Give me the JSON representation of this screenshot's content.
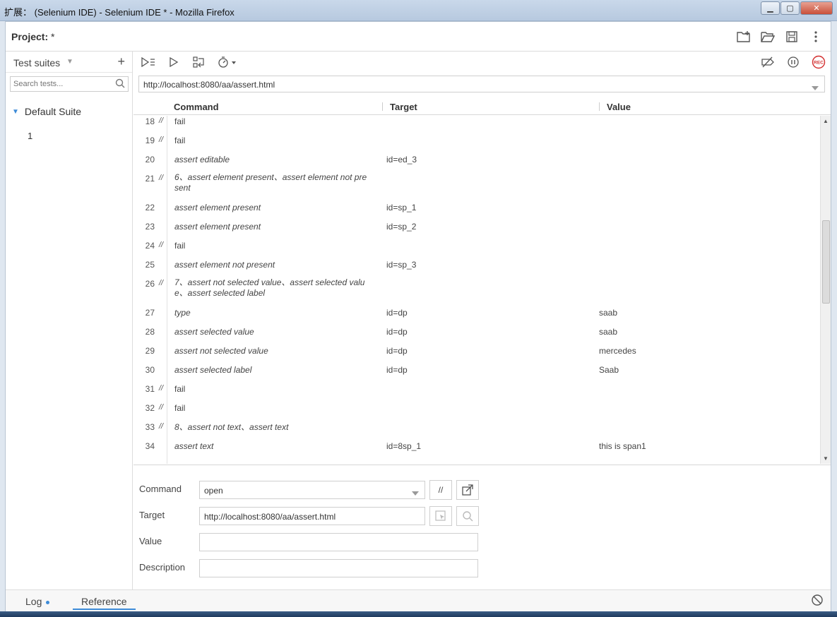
{
  "window": {
    "title": "扩展： (Selenium IDE) - Selenium IDE * - Mozilla Firefox"
  },
  "header": {
    "project_label": "Project:",
    "project_name": "*"
  },
  "sidebar": {
    "dropdown_label": "Test suites",
    "search_placeholder": "Search tests...",
    "suite_name": "Default Suite",
    "tests": [
      "1"
    ]
  },
  "url": {
    "value": "http://localhost:8080/aa/assert.html"
  },
  "grid": {
    "headers": {
      "command": "Command",
      "target": "Target",
      "value": "Value"
    },
    "rows": [
      {
        "num": "18",
        "comment": "//",
        "command": "fail",
        "target": "",
        "value": "",
        "italic": false
      },
      {
        "num": "19",
        "comment": "//",
        "command": "fail",
        "target": "",
        "value": "",
        "italic": false
      },
      {
        "num": "20",
        "comment": "",
        "command": "assert editable",
        "target": "id=ed_3",
        "value": "",
        "italic": true
      },
      {
        "num": "21",
        "comment": "//",
        "command": "6、assert element present、assert element not pre sent",
        "target": "",
        "value": "",
        "italic": true
      },
      {
        "num": "22",
        "comment": "",
        "command": "assert element present",
        "target": "id=sp_1",
        "value": "",
        "italic": true
      },
      {
        "num": "23",
        "comment": "",
        "command": "assert element present",
        "target": "id=sp_2",
        "value": "",
        "italic": true
      },
      {
        "num": "24",
        "comment": "//",
        "command": "fail",
        "target": "",
        "value": "",
        "italic": false
      },
      {
        "num": "25",
        "comment": "",
        "command": "assert element not present",
        "target": "id=sp_3",
        "value": "",
        "italic": true
      },
      {
        "num": "26",
        "comment": "//",
        "command": "7、assert not selected value、assert selected valu e、assert selected label",
        "target": "",
        "value": "",
        "italic": true
      },
      {
        "num": "27",
        "comment": "",
        "command": "type",
        "target": "id=dp",
        "value": "saab",
        "italic": true
      },
      {
        "num": "28",
        "comment": "",
        "command": "assert selected value",
        "target": "id=dp",
        "value": "saab",
        "italic": true
      },
      {
        "num": "29",
        "comment": "",
        "command": "assert not selected value",
        "target": "id=dp",
        "value": "mercedes",
        "italic": true
      },
      {
        "num": "30",
        "comment": "",
        "command": "assert selected label",
        "target": "id=dp",
        "value": "Saab",
        "italic": true
      },
      {
        "num": "31",
        "comment": "//",
        "command": "fail",
        "target": "",
        "value": "",
        "italic": false
      },
      {
        "num": "32",
        "comment": "//",
        "command": "fail",
        "target": "",
        "value": "",
        "italic": false
      },
      {
        "num": "33",
        "comment": "//",
        "command": "8、assert not text、assert text",
        "target": "",
        "value": "",
        "italic": true
      },
      {
        "num": "34",
        "comment": "",
        "command": "assert text",
        "target": "id=8sp_1",
        "value": "this is span1",
        "italic": true
      }
    ]
  },
  "editor": {
    "command_label": "Command",
    "command_value": "open",
    "target_label": "Target",
    "target_value": "http://localhost:8080/aa/assert.html",
    "value_label": "Value",
    "value_value": "",
    "description_label": "Description",
    "description_value": "",
    "comment_btn": "//"
  },
  "footer": {
    "log_tab": "Log",
    "reference_tab": "Reference"
  },
  "colors": {
    "accent": "#3d8bd8",
    "rec": "#d32f2f"
  }
}
